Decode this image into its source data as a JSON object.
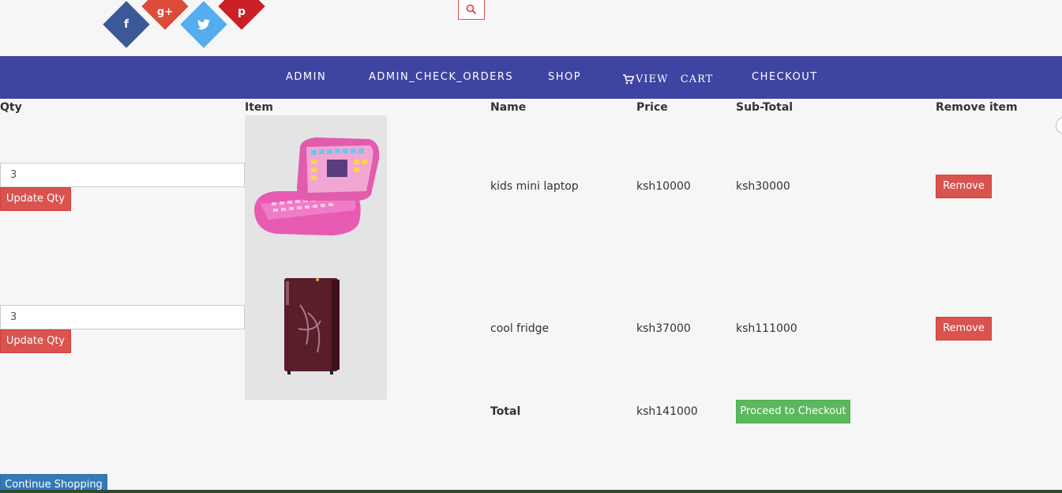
{
  "social": {
    "facebook": "f",
    "googleplus": "g+",
    "twitter": "twitter-icon",
    "pinterest": "p"
  },
  "nav": {
    "items": [
      "ADMIN",
      "ADMIN_CHECK_ORDERS",
      "SHOP",
      "VIEW   CART",
      "CHECKOUT"
    ]
  },
  "table": {
    "headers": {
      "qty": "Qty",
      "item": "Item",
      "name": "Name",
      "price": "Price",
      "subtotal": "Sub-Total",
      "remove": "Remove item"
    },
    "rows": [
      {
        "qty": "3",
        "update_label": "Update Qty",
        "name": "kids mini laptop",
        "price": "ksh10000",
        "subtotal": "ksh30000",
        "remove_label": "Remove"
      },
      {
        "qty": "3",
        "update_label": "Update Qty",
        "name": "cool fridge",
        "price": "ksh37000",
        "subtotal": "ksh111000",
        "remove_label": "Remove"
      }
    ],
    "total_label": "Total",
    "total_value": "ksh141000",
    "checkout_label": "Proceed to Checkout"
  },
  "continue_label": "Continue Shopping",
  "colors": {
    "nav_bg": "#3d44a2",
    "danger": "#d9534f",
    "success": "#5cb85c",
    "primary": "#337ab7"
  }
}
